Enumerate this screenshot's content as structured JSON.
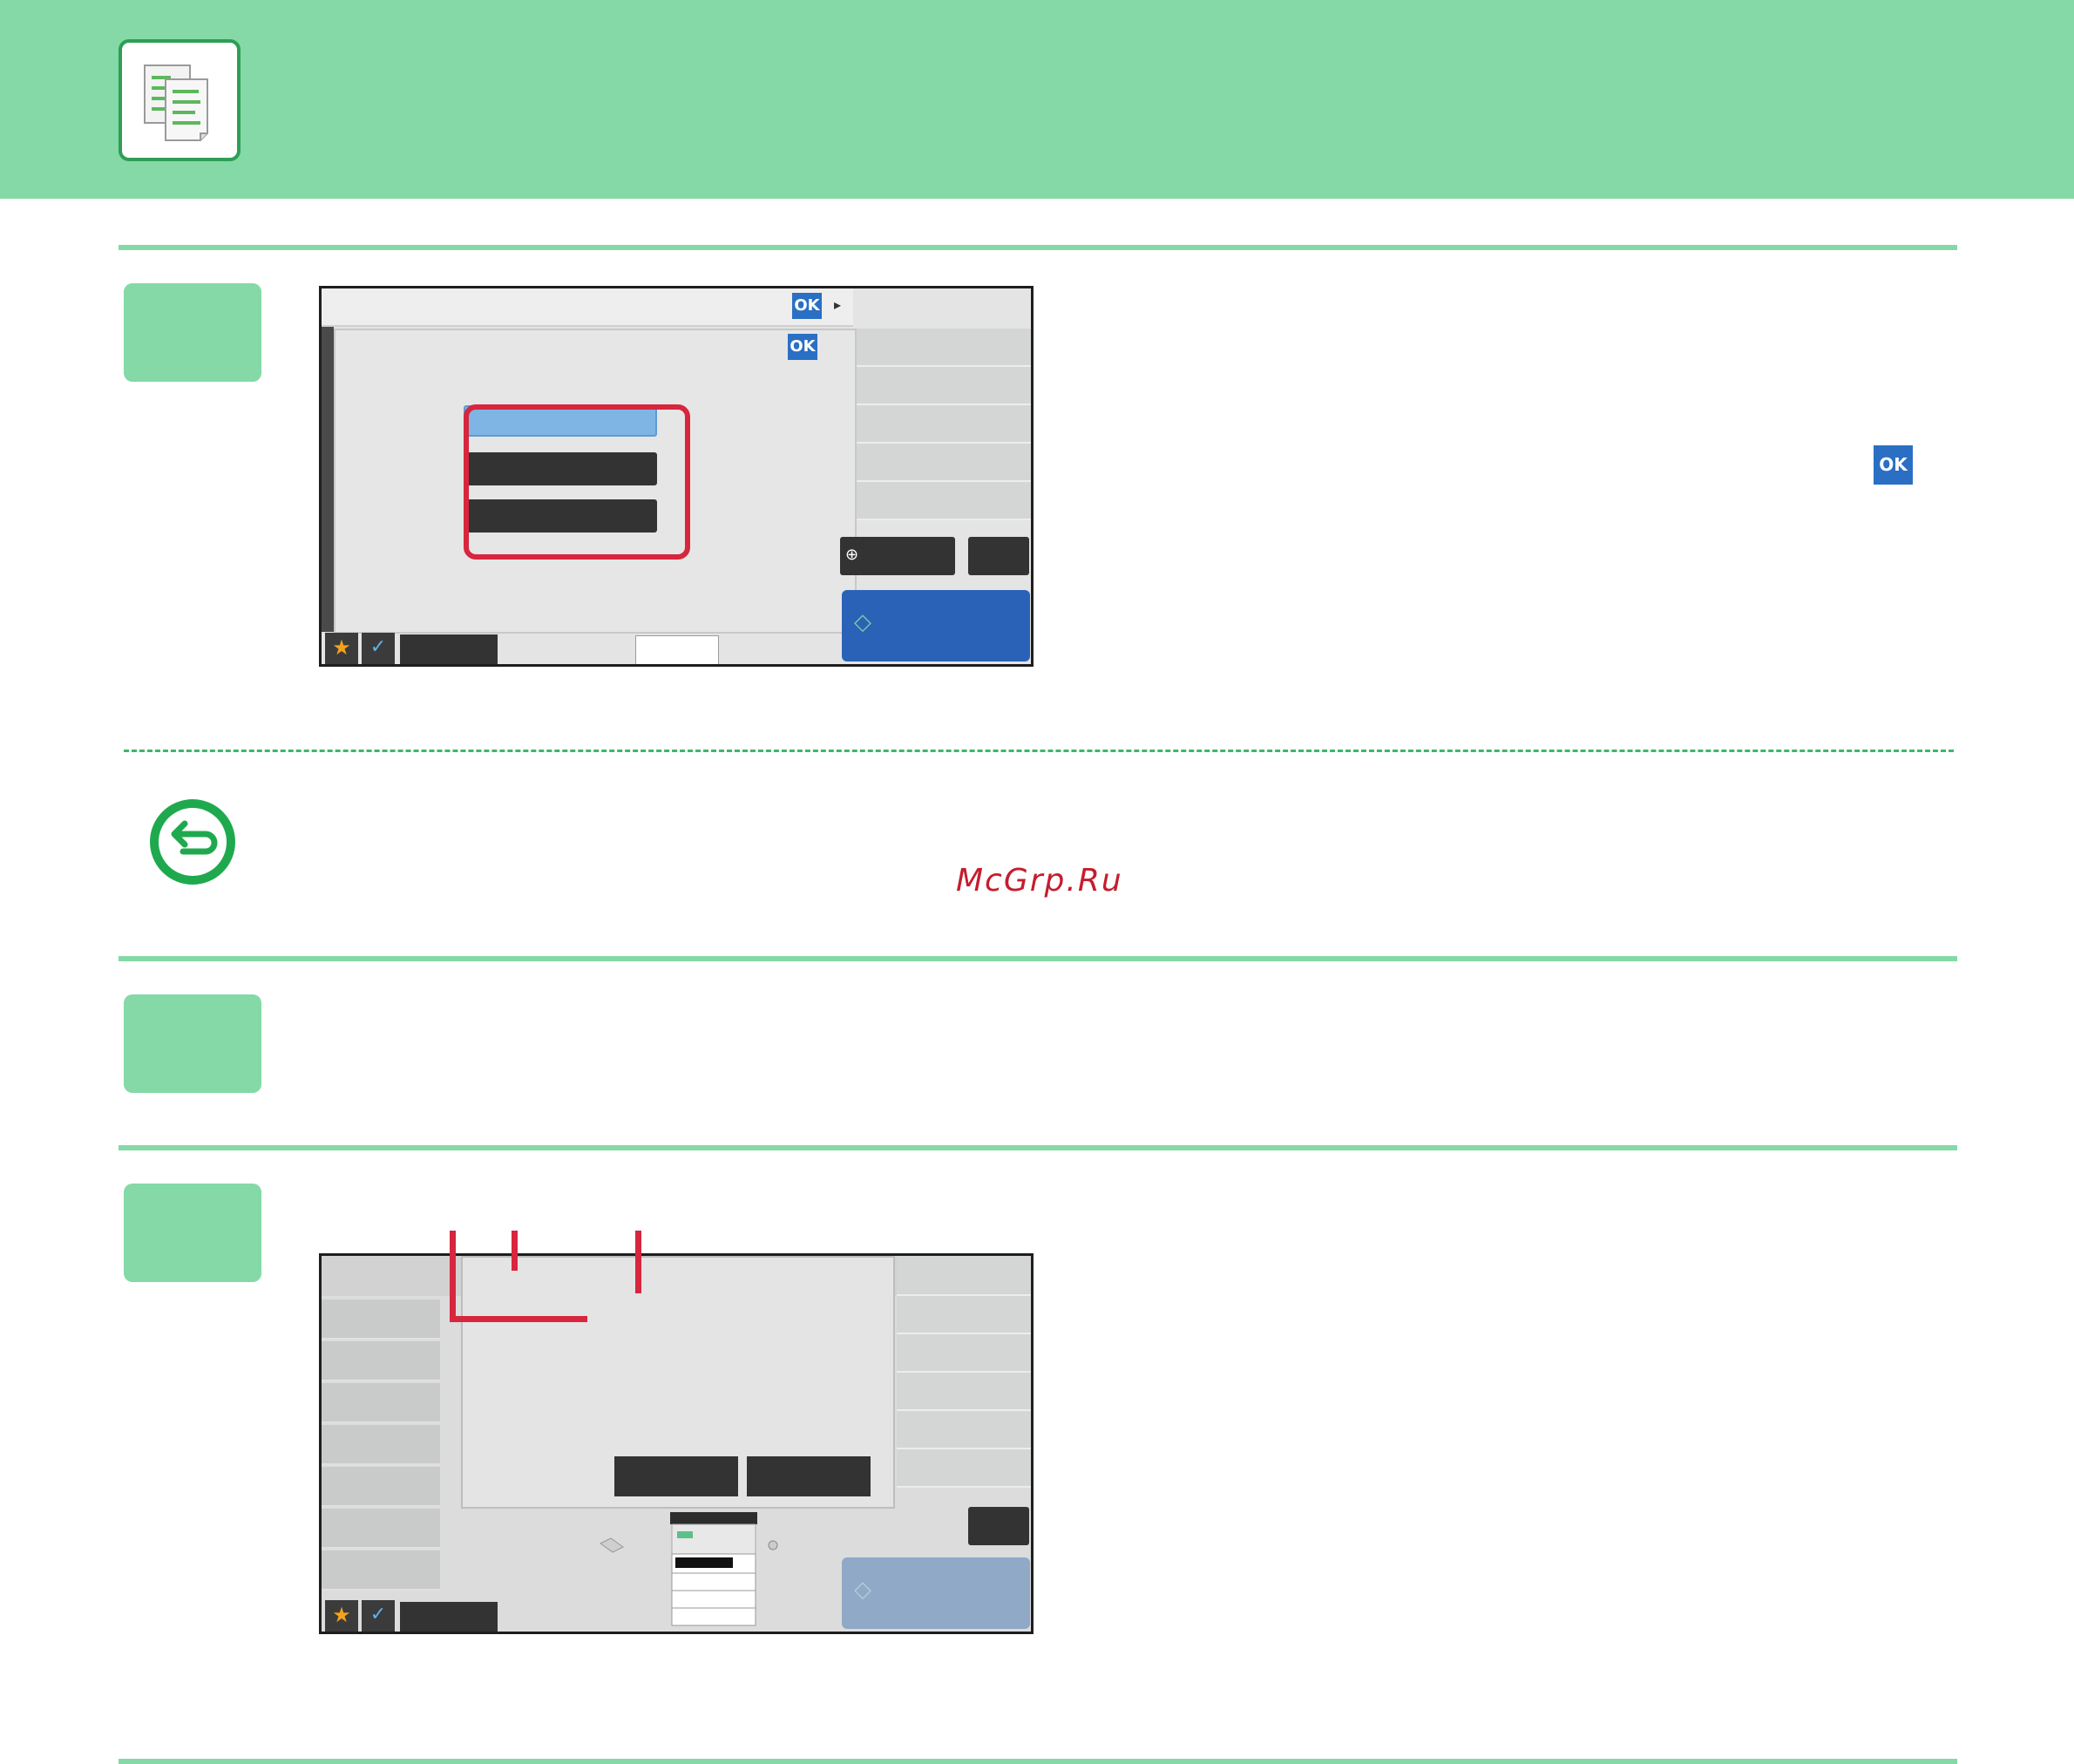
{
  "watermark": {
    "text": "McGrp.Ru"
  },
  "ok_button": {
    "label": "OK"
  },
  "colors": {
    "header_band": "#84d9a6",
    "accent_green": "#2f9e55",
    "callout_red": "#d7263d",
    "ok_blue": "#2a6fc4",
    "start_blue": "#2a62b8"
  },
  "icons": {
    "header": "copy-documents-icon",
    "return": "return-arrow-icon",
    "favorite": "star-icon",
    "check": "check-icon",
    "preview": "magnifier-icon",
    "start": "start-diamond-icon"
  }
}
